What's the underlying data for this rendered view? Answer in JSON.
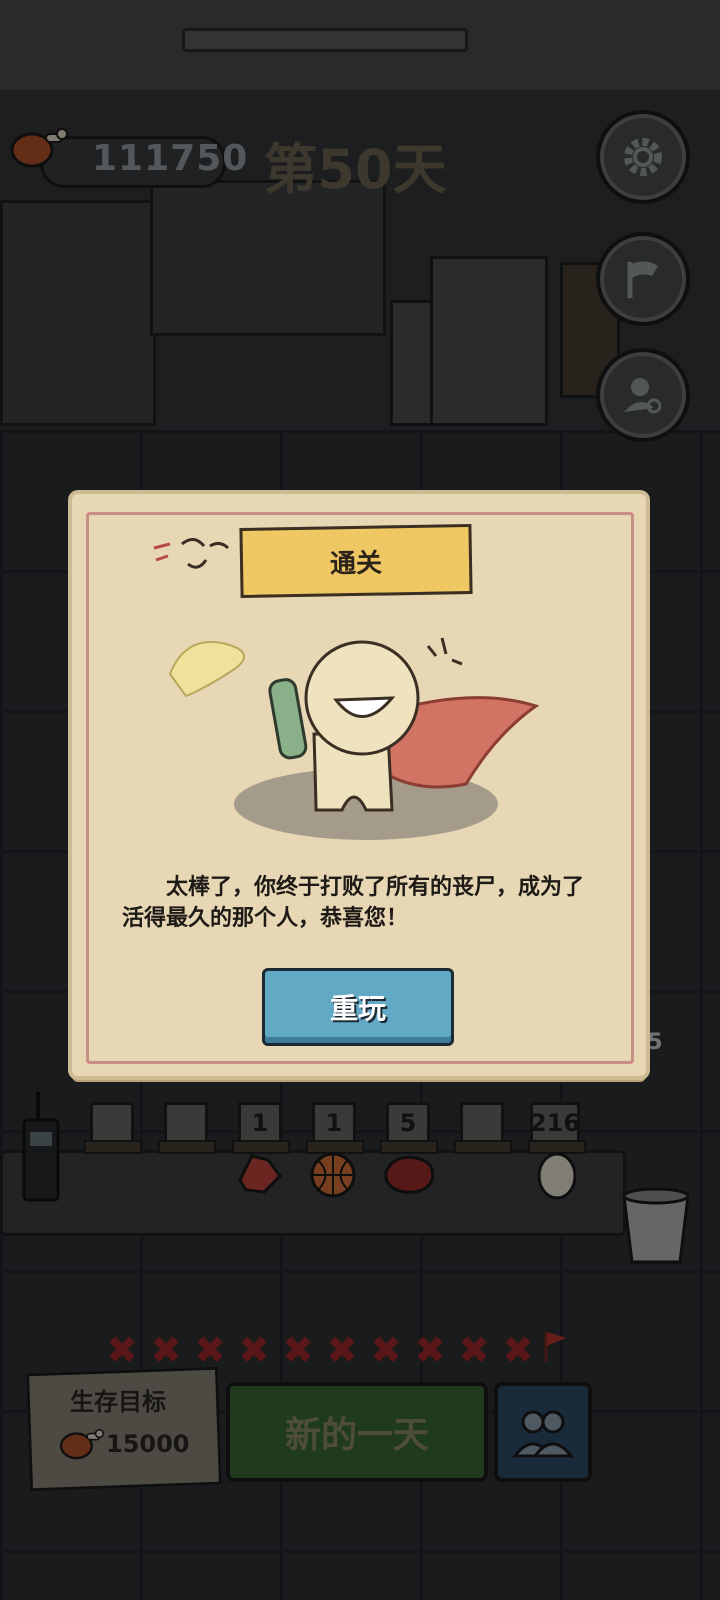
{
  "hud": {
    "food_count": "111750",
    "day_label": "第50天"
  },
  "side_buttons": [
    {
      "icon": "gear-icon"
    },
    {
      "icon": "flag-icon"
    },
    {
      "icon": "user-search-icon"
    }
  ],
  "dialog": {
    "title": "通关",
    "message": "太棒了，你终于打败了所有的丧尸，成为了活得最久的那个人，恭喜您！",
    "button_label": "重玩"
  },
  "inventory": {
    "counts": [
      "",
      "",
      "1",
      "1",
      "5",
      "",
      "216"
    ],
    "items": [
      "crystal-icon",
      "basketball-icon",
      "meat-icon",
      "egg-icon"
    ],
    "side_count": "05"
  },
  "progress": {
    "marks": 10,
    "end_icon": "red-flag-icon"
  },
  "bottom": {
    "goal_label": "生存目标",
    "goal_value": "15000",
    "new_day_label": "新的一天"
  },
  "colors": {
    "dialog_bg": "#e7d7b4",
    "title_banner": "#efc763",
    "replay_button": "#62a9c6",
    "new_day_button": "#3b6b3b",
    "cross_mark": "#a52a2a"
  }
}
